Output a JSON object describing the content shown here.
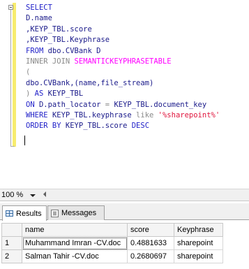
{
  "editor": {
    "lines": [
      [
        {
          "t": "SELECT",
          "c": "kw"
        }
      ],
      [
        {
          "t": "D.name",
          "c": "tx"
        }
      ],
      [
        {
          "t": ",KEYP_TBL.score",
          "c": "tx"
        }
      ],
      [
        {
          "t": ",KEYP_TBL.Keyphrase",
          "c": "tx"
        }
      ],
      [
        {
          "t": "FROM ",
          "c": "kw"
        },
        {
          "t": "dbo.CVBank D",
          "c": "tx"
        }
      ],
      [
        {
          "t": "INNER JOIN ",
          "c": "gr"
        },
        {
          "t": "SEMANTICKEYPHRASETABLE",
          "c": "pk"
        }
      ],
      [
        {
          "t": "(",
          "c": "gr"
        }
      ],
      [
        {
          "t": "dbo.CVBank,(name,file_stream)",
          "c": "tx"
        }
      ],
      [
        {
          "t": ") ",
          "c": "gr"
        },
        {
          "t": "AS ",
          "c": "kw"
        },
        {
          "t": "KEYP_TBL",
          "c": "tx"
        }
      ],
      [
        {
          "t": "ON ",
          "c": "kw"
        },
        {
          "t": "D.path_locator ",
          "c": "tx"
        },
        {
          "t": "= ",
          "c": "gr"
        },
        {
          "t": "KEYP_TBL.document_key",
          "c": "tx"
        }
      ],
      [
        {
          "t": "WHERE ",
          "c": "kw"
        },
        {
          "t": "KEYP_TBL.keyphrase ",
          "c": "tx"
        },
        {
          "t": "like ",
          "c": "gr"
        },
        {
          "t": "'%sharepoint%'",
          "c": "rd"
        }
      ],
      [
        {
          "t": "ORDER BY ",
          "c": "kw"
        },
        {
          "t": "KEYP_TBL.score ",
          "c": "tx"
        },
        {
          "t": "DESC",
          "c": "kw"
        }
      ]
    ]
  },
  "zoom": {
    "value": "100 %"
  },
  "tabs": {
    "results": "Results",
    "messages": "Messages"
  },
  "grid": {
    "columns": [
      "name",
      "score",
      "Keyphrase"
    ],
    "rows": [
      {
        "num": "1",
        "name": "Muhammand Imran -CV.doc",
        "score": "0.4881633",
        "keyphrase": "sharepoint"
      },
      {
        "num": "2",
        "name": "Salman Tahir -CV.doc",
        "score": "0.2680697",
        "keyphrase": "sharepoint"
      }
    ]
  }
}
